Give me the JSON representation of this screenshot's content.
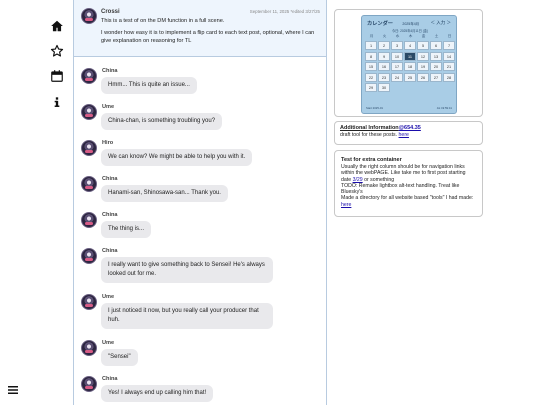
{
  "nav": {
    "items": [
      {
        "name": "home-icon"
      },
      {
        "name": "star-icon"
      },
      {
        "name": "calendar-icon"
      },
      {
        "name": "info-icon"
      }
    ],
    "menu": {
      "name": "hamburger-menu-icon"
    }
  },
  "pinned": {
    "author": "Crossi",
    "meta": "September 11, 2025 *edited 3/27/25",
    "line1": "This is a test of on the DM function in a full scene.",
    "line2": "I wonder how easy it is to implement a flip card to each text post, optional, where I can give explanation on reasoning for TL"
  },
  "messages": [
    {
      "name": "China",
      "text": "Hmm... This is quite an issue..."
    },
    {
      "name": "Ume",
      "text": "China-chan, is something troubling you?"
    },
    {
      "name": "Hiro",
      "text": "We can know? We might be able to help you with it."
    },
    {
      "name": "China",
      "text": "Hanami-san, Shinosawa-san... Thank you."
    },
    {
      "name": "China",
      "text": "The thing is..."
    },
    {
      "name": "China",
      "text": "I really want to give something back to Sensei! He's always looked out for me."
    },
    {
      "name": "Ume",
      "text": "I just noticed it now, but you really call your producer that huh."
    },
    {
      "name": "Ume",
      "text": "\"Sensei\""
    },
    {
      "name": "China",
      "text": "Yes! I always end up calling him that!"
    }
  ],
  "calendar": {
    "title": "カレンダー",
    "month": "2025年4月",
    "nav": "＜ 入力 ＞",
    "subtitle": "今日: 2025年4月11日 (金)",
    "weekdays": [
      "月",
      "火",
      "水",
      "木",
      "金",
      "土",
      "日"
    ],
    "days": [
      "1",
      "2",
      "3",
      "4",
      "5",
      "6",
      "7",
      "8",
      "9",
      "10",
      "11",
      "12",
      "13",
      "14",
      "15",
      "16",
      "17",
      "18",
      "19",
      "20",
      "21",
      "22",
      "23",
      "24",
      "25",
      "26",
      "27",
      "28",
      "29",
      "30"
    ],
    "today": "11",
    "footer_left": "Start 2025-01",
    "footer_right": "Jst 19:59:41"
  },
  "info": {
    "title_text": "Additional Information",
    "title_link": "@654.35",
    "body": "draft tool for these posts.",
    "link": "here"
  },
  "test": {
    "title": "Test for extra container",
    "line1": "Usually the right column should be for navigation links within the webPAGE. Like take me to first post starting date",
    "date_link": "3/29",
    "line2": "or something",
    "line3": "TODO: Remake lightbox alt-text handling. Treat like Bluesky's",
    "line4": "Made a directory for all website based \"tools\" I had made:",
    "link": "here"
  }
}
